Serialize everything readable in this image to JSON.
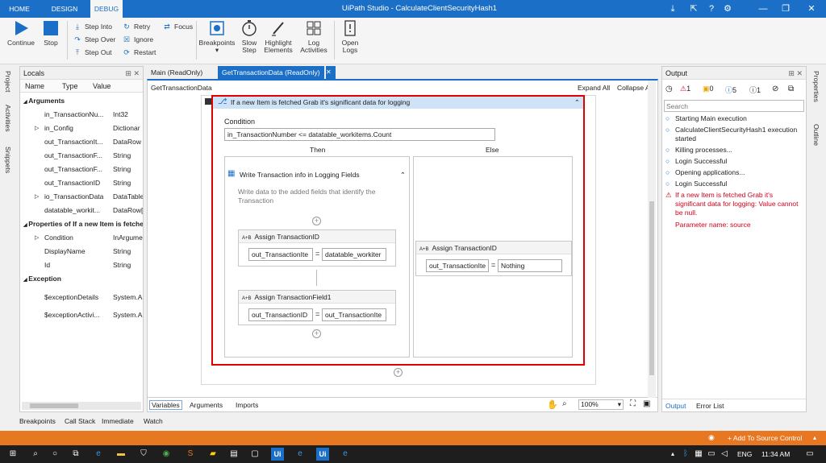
{
  "app": {
    "title": "UiPath Studio - CalculateClientSecurityHash1",
    "ribbon_tabs": [
      "HOME",
      "DESIGN",
      "DEBUG"
    ]
  },
  "ribbon": {
    "continue": "Continue",
    "stop": "Stop",
    "step_into": "Step Into",
    "step_over": "Step Over",
    "step_out": "Step Out",
    "retry": "Retry",
    "ignore": "Ignore",
    "restart": "Restart",
    "focus": "Focus",
    "breakpoints": "Breakpoints",
    "slow_step_1": "Slow",
    "slow_step_2": "Step",
    "highlight_1": "Highlight",
    "highlight_2": "Elements",
    "log_1": "Log",
    "log_2": "Activities",
    "open_logs_1": "Open",
    "open_logs_2": "Logs"
  },
  "left_vtabs": [
    "Project",
    "Activities",
    "Snippets"
  ],
  "right_vtabs": [
    "Properties",
    "Outline"
  ],
  "locals": {
    "title": "Locals",
    "pin": "⊞ ✕",
    "columns": [
      "Name",
      "Type",
      "Value"
    ],
    "sections": {
      "arguments": "Arguments",
      "properties": "Properties of If a new Item is fetched",
      "exception": "Exception"
    },
    "arguments": [
      {
        "name": "in_TransactionNu...",
        "type": "Int32",
        "exp": false
      },
      {
        "name": "in_Config",
        "type": "Dictionar",
        "exp": true
      },
      {
        "name": "out_TransactionIt...",
        "type": "DataRow",
        "exp": false
      },
      {
        "name": "out_TransactionF...",
        "type": "String",
        "exp": false
      },
      {
        "name": "out_TransactionF...",
        "type": "String",
        "exp": false
      },
      {
        "name": "out_TransactionID",
        "type": "String",
        "exp": false
      },
      {
        "name": "io_TransactionData",
        "type": "DataTable",
        "exp": true
      },
      {
        "name": "datatable_workit...",
        "type": "DataRow[",
        "exp": false
      }
    ],
    "properties": [
      {
        "name": "Condition",
        "type": "InArgume",
        "exp": true
      },
      {
        "name": "DisplayName",
        "type": "String",
        "exp": false
      },
      {
        "name": "Id",
        "type": "String",
        "exp": false
      }
    ],
    "exception": [
      {
        "name": "$exceptionDetails",
        "type": "System.A",
        "exp": false
      },
      {
        "name": "$exceptionActivi...",
        "type": "System.A",
        "exp": false
      }
    ]
  },
  "designer": {
    "tabs": [
      "Main (ReadOnly)",
      "GetTransactionData (ReadOnly)"
    ],
    "breadcrumb": "GetTransactionData",
    "expand_all": "Expand All",
    "collapse_all": "Collapse All",
    "if_title": "If a new Item is fetched Grab it's significant data for logging",
    "condition_label": "Condition",
    "condition_value": "in_TransactionNumber <= datatable_workitems.Count",
    "then_label": "Then",
    "else_label": "Else",
    "sequence_title": "Write Transaction info in Logging Fields",
    "sequence_desc": "Write data to the added fields that identify the Transaction",
    "assign1_title": "Assign TransactionID",
    "assign1_left": "out_TransactionIte",
    "assign1_right": "datatable_workiter",
    "assign2_title": "Assign TransactionField1",
    "assign2_left": "out_TransactionID",
    "assign2_right": "out_TransactionIte",
    "else_assign_title": "Assign TransactionID",
    "else_assign_left": "out_TransactionIte",
    "else_assign_right": "Nothing",
    "assign_icon": "A+B",
    "eq": "=",
    "bottom_tabs": [
      "Variables",
      "Arguments",
      "Imports"
    ],
    "zoom": "100%"
  },
  "output": {
    "title": "Output",
    "counts": [
      "1",
      "0",
      "5",
      "1"
    ],
    "search_placeholder": "Search",
    "lines": [
      {
        "text": "Starting Main execution",
        "error": false
      },
      {
        "text": "CalculateClientSecurityHash1 execution started",
        "error": false
      },
      {
        "text": "Killing processes...",
        "error": false
      },
      {
        "text": "Login Successful",
        "error": false
      },
      {
        "text": "Opening applications...",
        "error": false
      },
      {
        "text": "Login Successful",
        "error": false
      },
      {
        "text": "If a new Item is fetched Grab it's significant data for logging: Value cannot be null.",
        "error": true
      },
      {
        "text": "Parameter name: source",
        "error": true
      }
    ],
    "bottom_tabs": [
      "Output",
      "Error List"
    ]
  },
  "bottom_panel_tabs": [
    "Breakpoints",
    "Call Stack",
    "Immediate",
    "Watch"
  ],
  "statusbar": {
    "source_control": "+ Add To Source Control"
  },
  "taskbar": {
    "language": "ENG",
    "time": "11:34 AM"
  },
  "colors": {
    "accent": "#1c6fc7",
    "error": "#d0021b",
    "status": "#e87722"
  }
}
